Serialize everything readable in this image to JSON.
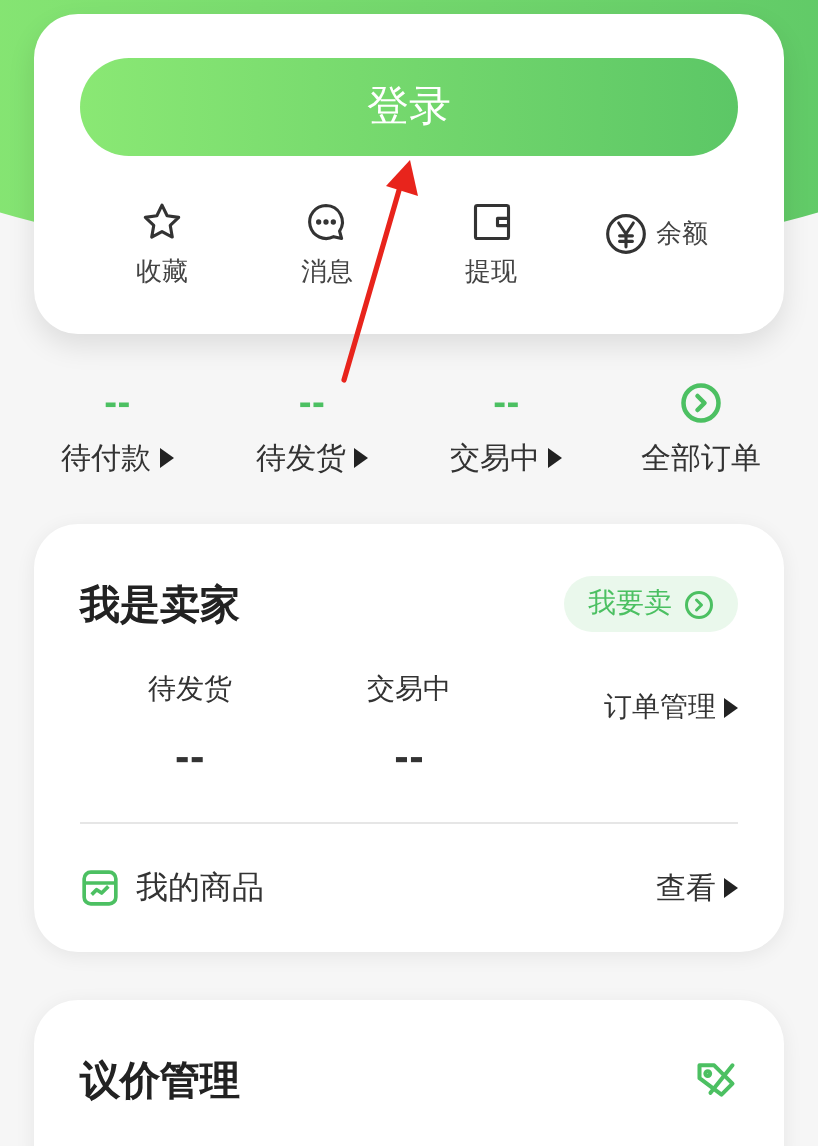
{
  "login_button": {
    "label": "登录"
  },
  "shortcuts": [
    {
      "kind": "star",
      "label": "收藏"
    },
    {
      "kind": "message",
      "label": "消息"
    },
    {
      "kind": "wallet",
      "label": "提现"
    },
    {
      "kind": "yen",
      "label": "余额"
    }
  ],
  "order_stats": [
    {
      "kind": "count",
      "value": "--",
      "label": "待付款"
    },
    {
      "kind": "count",
      "value": "--",
      "label": "待发货"
    },
    {
      "kind": "count",
      "value": "--",
      "label": "交易中"
    },
    {
      "kind": "all",
      "label": "全部订单"
    }
  ],
  "seller_card": {
    "title": "我是卖家",
    "sell_button": "我要卖",
    "stats": [
      {
        "label": "待发货",
        "value": "--"
      },
      {
        "label": "交易中",
        "value": "--"
      }
    ],
    "order_link": "订单管理",
    "goods_label": "我的商品",
    "view_link": "查看"
  },
  "negotiation_card": {
    "title": "议价管理"
  }
}
